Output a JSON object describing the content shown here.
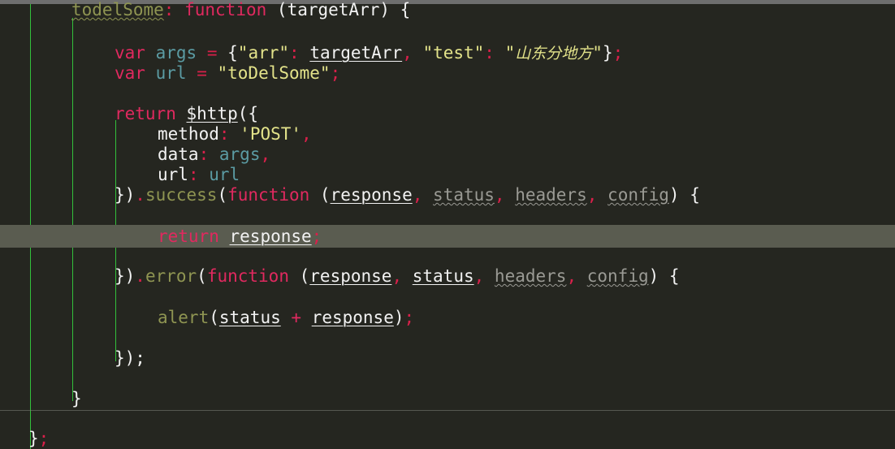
{
  "editor": {
    "theme": {
      "background": "#252620",
      "current_line_background": "#5a5c50",
      "indent_guide_color": "#33c03b",
      "top_strip_color": "#6e6e6e",
      "separator_color": "#7d8079",
      "keyword_color": "#e0295f",
      "function_color": "#8f9552",
      "string_color": "#e3e38a",
      "variable_color": "#5b9ba3",
      "plain_color": "#f2f2f2",
      "punctuation_color": "#d8204a",
      "dimmed_color": "#9a9a94"
    },
    "language": "JavaScript",
    "current_line_number": 7
  },
  "code": {
    "line1": {
      "name": "todelSome",
      "colon": ":",
      "keyword": "function",
      "open_paren": " (",
      "param": "targetArr",
      "close": ") {"
    },
    "line2": {
      "kw": "var",
      "name": "args",
      "eq": "=",
      "brace_open": "{",
      "key_arr": "\"arr\"",
      "colon1": ":",
      "value_arr": "targetArr",
      "comma1": ",",
      "key_test": "\"test\"",
      "colon2": ":",
      "quote_open": "\"",
      "cjk_value": "山东分地方",
      "quote_close": "\"",
      "brace_close": "}",
      "semi": ";"
    },
    "line3": {
      "kw": "var",
      "name": "url",
      "eq": "=",
      "value": "\"toDelSome\"",
      "semi": ";"
    },
    "line4": {
      "kw": "return",
      "callee": "$http",
      "open": "({"
    },
    "line5": {
      "key": "method",
      "colon": ":",
      "value": "'POST'",
      "comma": ","
    },
    "line6": {
      "key": "data",
      "colon": ":",
      "value": "args",
      "comma": ","
    },
    "line7": {
      "key": "url",
      "colon": ":",
      "value": "url"
    },
    "line8": {
      "close": "})",
      "dot": ".",
      "method": "success",
      "open_paren": "(",
      "keyword": "function",
      "paren2": " (",
      "p1": "response",
      "c1": ",",
      "p2": "status",
      "c2": ",",
      "p3": "headers",
      "c3": ",",
      "p4": "config",
      "tail": ") {"
    },
    "line9": {
      "kw": "return",
      "value": "response",
      "semi": ";"
    },
    "line10": {
      "close": "})",
      "dot": ".",
      "method": "error",
      "open_paren": "(",
      "keyword": "function",
      "paren2": " (",
      "p1": "response",
      "c1": ",",
      "p2": "status",
      "c2": ",",
      "p3": "headers",
      "c3": ",",
      "p4": "config",
      "tail": ") {"
    },
    "line11": {
      "fn": "alert",
      "open": "(",
      "a1": "status",
      "op": "+",
      "a2": "response",
      "close": ")",
      "semi": ";"
    },
    "line12": {
      "text": "});"
    },
    "line13": {
      "text": "}"
    },
    "line14": {
      "brace": "}",
      "semi": ";"
    }
  }
}
